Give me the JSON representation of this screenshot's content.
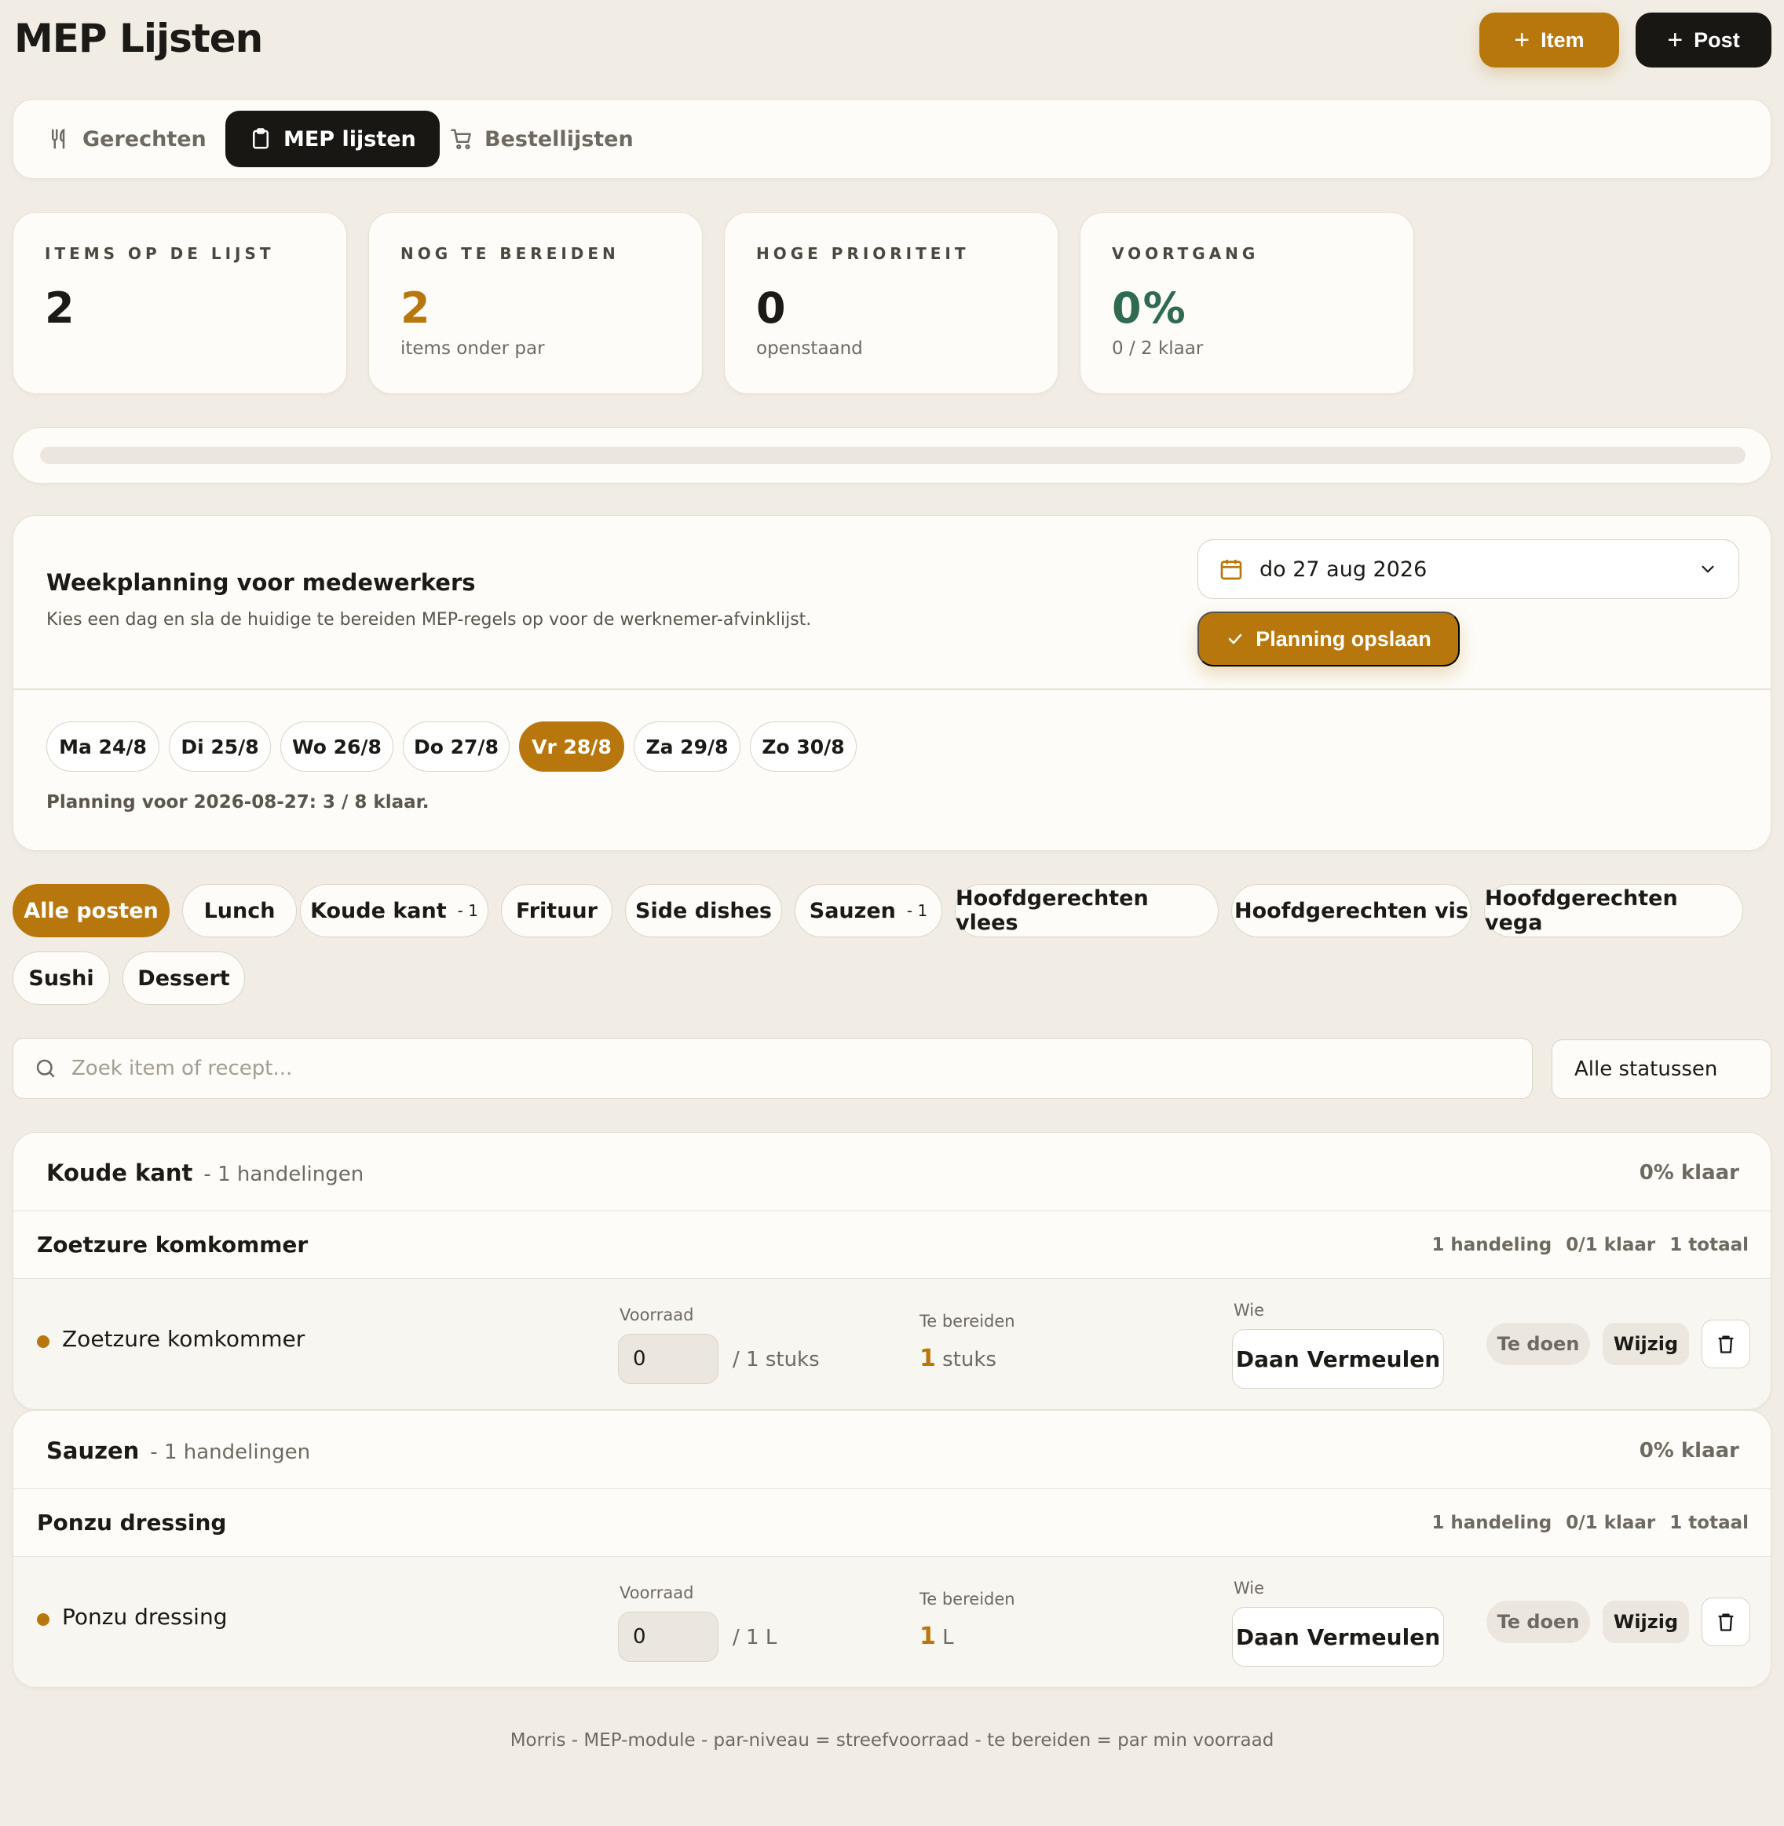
{
  "header": {
    "title": "MEP Lijsten",
    "add_item_label": "Item",
    "add_post_label": "Post"
  },
  "tabs": [
    {
      "label": "Gerechten",
      "icon": "utensils-icon",
      "active": false
    },
    {
      "label": "MEP lijsten",
      "icon": "clipboard-icon",
      "active": true
    },
    {
      "label": "Bestellijsten",
      "icon": "cart-icon",
      "active": false
    }
  ],
  "stats": [
    {
      "label": "ITEMS OP DE LIJST",
      "value": "2",
      "sub": ""
    },
    {
      "label": "NOG TE BEREIDEN",
      "value": "2",
      "sub": "items onder par"
    },
    {
      "label": "HOGE PRIORITEIT",
      "value": "0",
      "sub": "openstaand"
    },
    {
      "label": "VOORTGANG",
      "value": "0%",
      "sub": "0 / 2 klaar"
    }
  ],
  "progress": {
    "fraction": 0
  },
  "planning": {
    "title": "Weekplanning voor medewerkers",
    "description": "Kies een dag en sla de huidige te bereiden MEP-regels op voor de werknemer-afvinklijst.",
    "selected_date": "do 27 aug 2026",
    "save_label": "Planning opslaan",
    "days": [
      {
        "label": "Ma 24/8",
        "active": false
      },
      {
        "label": "Di 25/8",
        "active": false
      },
      {
        "label": "Wo 26/8",
        "active": false
      },
      {
        "label": "Do 27/8",
        "active": false
      },
      {
        "label": "Vr 28/8",
        "active": true
      },
      {
        "label": "Za 29/8",
        "active": false
      },
      {
        "label": "Zo 30/8",
        "active": false
      }
    ],
    "status_text": "Planning voor 2026-08-27: 3 / 8 klaar."
  },
  "posts": [
    {
      "label": "Alle posten",
      "count": "",
      "active": true
    },
    {
      "label": "Lunch",
      "count": "",
      "active": false
    },
    {
      "label": "Koude kant",
      "count": "- 1",
      "active": false
    },
    {
      "label": "Frituur",
      "count": "",
      "active": false
    },
    {
      "label": "Side dishes",
      "count": "",
      "active": false
    },
    {
      "label": "Sauzen",
      "count": "- 1",
      "active": false
    },
    {
      "label": "Hoofdgerechten vlees",
      "count": "",
      "active": false
    },
    {
      "label": "Hoofdgerechten vis",
      "count": "",
      "active": false
    },
    {
      "label": "Hoofdgerechten vega",
      "count": "",
      "active": false
    },
    {
      "label": "Sushi",
      "count": "",
      "active": false
    },
    {
      "label": "Dessert",
      "count": "",
      "active": false
    }
  ],
  "search": {
    "placeholder": "Zoek item of recept...",
    "value": ""
  },
  "status_filter": {
    "selected": "Alle statussen"
  },
  "sections": [
    {
      "title": "Koude kant",
      "subtitle": "- 1 handelingen",
      "done": "0% klaar",
      "group": {
        "title": "Zoetzure komkommer",
        "actions": "1 handeling",
        "done": "0/1 klaar",
        "total": "1 totaal"
      },
      "item": {
        "name": "Zoetzure komkommer",
        "stock_label": "Voorraad",
        "stock_value": "0",
        "par": "/ 1 stuks",
        "prep_label": "Te bereiden",
        "prep_amount": "1",
        "prep_unit": "stuks",
        "who_label": "Wie",
        "who": "Daan Vermeulen",
        "status": "Te doen",
        "edit_label": "Wijzig"
      }
    },
    {
      "title": "Sauzen",
      "subtitle": "- 1 handelingen",
      "done": "0% klaar",
      "group": {
        "title": "Ponzu dressing",
        "actions": "1 handeling",
        "done": "0/1 klaar",
        "total": "1 totaal"
      },
      "item": {
        "name": "Ponzu dressing",
        "stock_label": "Voorraad",
        "stock_value": "0",
        "par": "/ 1 L",
        "prep_label": "Te bereiden",
        "prep_amount": "1",
        "prep_unit": "L",
        "who_label": "Wie",
        "who": "Daan Vermeulen",
        "status": "Te doen",
        "edit_label": "Wijzig"
      }
    }
  ],
  "footer": "Morris - MEP-module - par-niveau = streefvoorraad - te bereiden = par min voorraad",
  "colors": {
    "accent": "#b7770c",
    "dark": "#181714",
    "background": "#f1ede5",
    "progress_green": "#2f6b4f"
  }
}
